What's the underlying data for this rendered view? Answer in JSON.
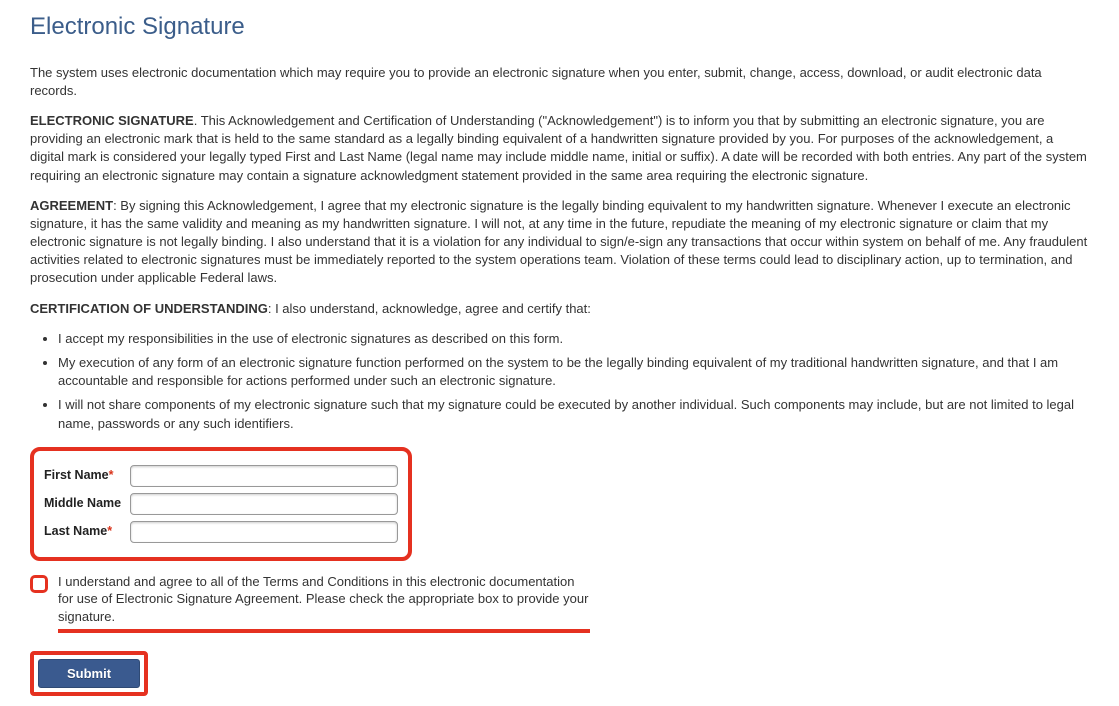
{
  "title": "Electronic Signature",
  "intro": "The system uses electronic documentation which may require you to provide an electronic signature when you enter, submit, change, access, download, or audit electronic data records.",
  "es": {
    "label": "ELECTRONIC SIGNATURE",
    "text": ". This Acknowledgement and Certification of Understanding (\"Acknowledgement\") is to inform you that by submitting an electronic signature, you are providing an electronic mark that is held to the same standard as a legally binding equivalent of a handwritten signature provided by you. For purposes of the acknowledgement, a digital mark is considered your legally typed First and Last Name (legal name may include middle name, initial or suffix). A date will be recorded with both entries. Any part of the system requiring an electronic signature may contain a signature acknowledgment statement provided in the same area requiring the electronic signature."
  },
  "agreement": {
    "label": "AGREEMENT",
    "text": ": By signing this Acknowledgement, I agree that my electronic signature is the legally binding equivalent to my handwritten signature. Whenever I execute an electronic signature, it has the same validity and meaning as my handwritten signature. I will not, at any time in the future, repudiate the meaning of my electronic signature or claim that my electronic signature is not legally binding. I also understand that it is a violation for any individual to sign/e-sign any transactions that occur within system on behalf of me. Any fraudulent activities related to electronic signatures must be immediately reported to the system operations team. Violation of these terms could lead to disciplinary action, up to termination, and prosecution under applicable Federal laws."
  },
  "cert": {
    "label": "CERTIFICATION OF UNDERSTANDING",
    "text": ": I also understand, acknowledge, agree and certify that:",
    "items": [
      "I accept my responsibilities in the use of electronic signatures as described on this form.",
      "My execution of any form of an electronic signature function performed on the system to be the legally binding equivalent of my traditional handwritten signature, and that I am accountable and responsible for actions performed under such an electronic signature.",
      "I will not share components of my electronic signature such that my signature could be executed by another individual. Such components may include, but are not limited to legal name, passwords or any such identifiers."
    ]
  },
  "form": {
    "first_label": "First Name",
    "middle_label": "Middle Name",
    "last_label": "Last Name",
    "required": "*",
    "first_value": "",
    "middle_value": "",
    "last_value": ""
  },
  "consent": "I understand and agree to all of the Terms and Conditions in this electronic documentation for use of Electronic Signature Agreement. Please check the appropriate box to provide your signature.",
  "submit_label": "Submit"
}
